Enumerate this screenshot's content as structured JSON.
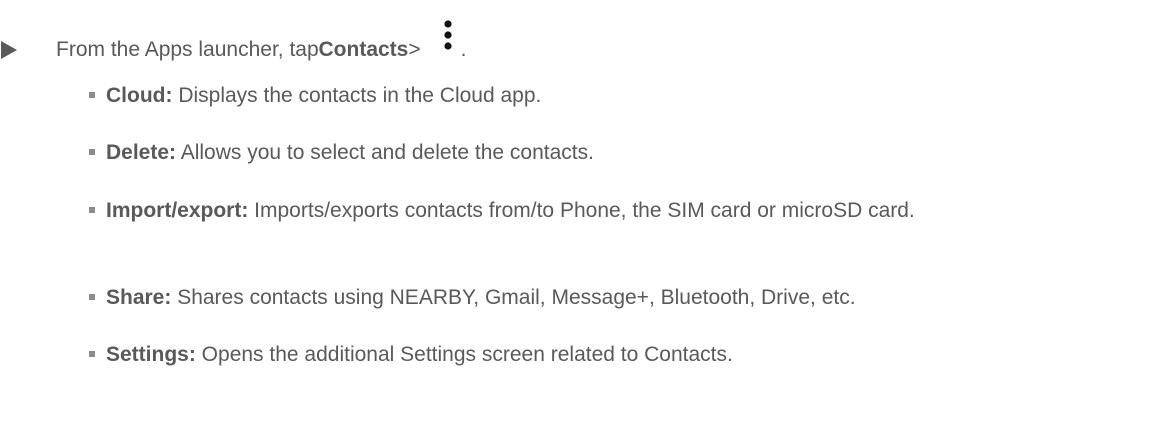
{
  "step": {
    "prefix": "From the Apps launcher, tap ",
    "bold": "Contacts",
    "sep": " >",
    "suffix": "."
  },
  "items": [
    {
      "term": "Cloud:",
      "desc": " Displays the contacts in the Cloud app."
    },
    {
      "term": "Delete:",
      "desc": " Allows you to select and delete the contacts."
    },
    {
      "term": "Import/export:",
      "desc": " Imports/exports contacts from/to Phone, the SIM card or microSD card."
    },
    {
      "term": "Share:",
      "desc": " Shares contacts using NEARBY, Gmail, Message+, Bluetooth, Drive, etc."
    },
    {
      "term": "Settings:",
      "desc": " Opens the additional Settings screen related to Contacts."
    }
  ],
  "icons": {
    "step_marker": "play-arrow-icon",
    "menu": "more-options-icon",
    "bullet": "square-bullet-icon"
  }
}
